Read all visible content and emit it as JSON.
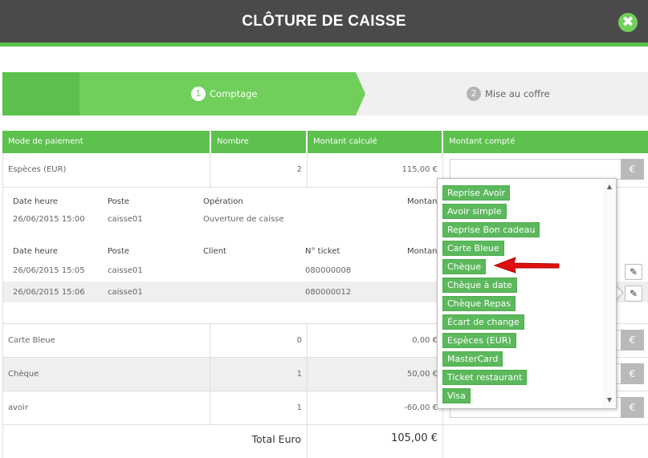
{
  "window": {
    "title": "CLÔTURE DE CAISSE",
    "close_glyph": "✖"
  },
  "colors": {
    "header_bg": "#4a4a4a",
    "accent": "#5cc14d",
    "step_active": "#6fcf5a",
    "step_inactive": "#f0f0f0",
    "dropdown_item": "#5cb85c",
    "annotation_arrow": "#e01010"
  },
  "stepper": {
    "steps": [
      {
        "num": "1",
        "label": "Comptage",
        "active": true
      },
      {
        "num": "2",
        "label": "Mise au coffre",
        "active": false
      }
    ]
  },
  "table": {
    "headers": [
      "Mode de paiement",
      "Nombre",
      "Montant calculé",
      "Montant compté"
    ],
    "currency_icon": "€",
    "especes": {
      "mode": "Espèces (EUR)",
      "nombre": "2",
      "montant": "115,00 €"
    },
    "detail1": {
      "headers": [
        "Date heure",
        "Poste",
        "Opération",
        "Montant"
      ],
      "rows": [
        {
          "date": "26/06/2015 15:00",
          "poste": "caisse01",
          "operation": "Ouverture de caisse"
        }
      ]
    },
    "detail2": {
      "headers": [
        "Date heure",
        "Poste",
        "Client",
        "N° ticket",
        "Montant"
      ],
      "rows": [
        {
          "date": "26/06/2015 15:05",
          "poste": "caisse01",
          "ticket": "080000008"
        },
        {
          "date": "26/06/2015 15:06",
          "poste": "caisse01",
          "ticket": "080000012"
        }
      ]
    },
    "rows": [
      {
        "mode": "Carte Bleue",
        "nombre": "0",
        "montant": "0,00 €"
      },
      {
        "mode": "Chèque",
        "nombre": "1",
        "montant": "50,00 €"
      },
      {
        "mode": "avoir",
        "nombre": "1",
        "montant": "-60,00 €"
      }
    ],
    "total": {
      "label": "Total Euro",
      "value": "105,00 €"
    }
  },
  "dropdown": {
    "options": [
      "Reprise Avoir",
      "Avoir simple",
      "Reprise Bon cadeau",
      "Carte Bleue",
      "Chèque",
      "Chèque à date",
      "Chèque Repas",
      "Écart de change",
      "Espèces (EUR)",
      "MasterCard",
      "Ticket restaurant",
      "Visa"
    ],
    "highlighted": "Chèque"
  },
  "icons": {
    "edit": "pencil-icon",
    "close": "close-icon",
    "scroll_up": "▲",
    "scroll_down": "▼"
  }
}
